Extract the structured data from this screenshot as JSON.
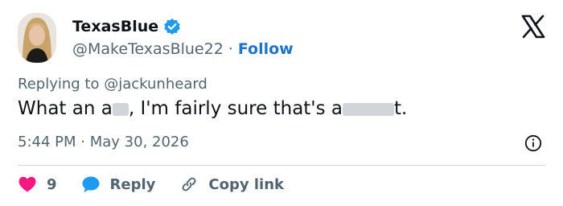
{
  "author": {
    "display_name": "TexasBlue",
    "handle": "@MakeTexasBlue22",
    "separator": "·",
    "follow_label": "Follow",
    "avatar_icon": "profile-photo",
    "verified_icon": "verified-badge-icon"
  },
  "logo_icon": "x-logo-icon",
  "reply_context": {
    "prefix": "Replying to",
    "handle": "@jackunheard"
  },
  "tweet": {
    "text_part1": "What an a",
    "text_part2": ", I'm fairly sure that's a",
    "text_part3": "t."
  },
  "meta": {
    "time": "5:44 PM",
    "separator": "·",
    "date": "May 30, 2026"
  },
  "actions": {
    "like_count": "9",
    "reply_label": "Reply",
    "copy_label": "Copy link"
  },
  "colors": {
    "accent": "#1d74c8",
    "verified": "#1d9bf0",
    "like": "#f91880",
    "muted": "#536471",
    "text": "#0f1419"
  }
}
